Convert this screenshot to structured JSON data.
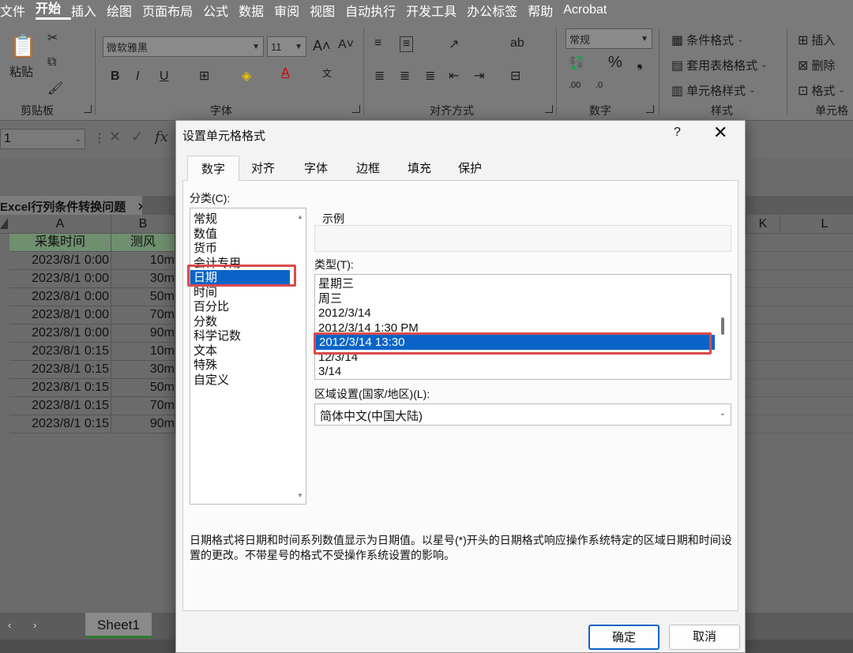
{
  "menu": [
    "文件",
    "开始",
    "插入",
    "绘图",
    "页面布局",
    "公式",
    "数据",
    "审阅",
    "视图",
    "自动执行",
    "开发工具",
    "办公标签",
    "帮助",
    "Acrobat"
  ],
  "ribbon": {
    "clipboard": {
      "paste": "粘贴",
      "group": "剪贴板"
    },
    "font": {
      "name": "微软雅黑",
      "size": "11",
      "group": "字体"
    },
    "align": {
      "group": "对齐方式"
    },
    "number": {
      "format": "常规",
      "group": "数字"
    },
    "styles": {
      "conditional": "条件格式",
      "table": "套用表格格式",
      "cell": "单元格样式",
      "group": "样式"
    },
    "cells": {
      "insert": "插入",
      "delete": "删除",
      "format": "格式",
      "group": "单元格"
    }
  },
  "formula": {
    "namebox": "1"
  },
  "workbook": {
    "tab": "Excel行列条件转换问题"
  },
  "sheet": {
    "columns": [
      "A",
      "B",
      "K",
      "L"
    ],
    "header": [
      "采集时间",
      "测风"
    ],
    "rows": [
      [
        "2023/8/1 0:00",
        "10m"
      ],
      [
        "2023/8/1 0:00",
        "30m"
      ],
      [
        "2023/8/1 0:00",
        "50m"
      ],
      [
        "2023/8/1 0:00",
        "70m"
      ],
      [
        "2023/8/1 0:00",
        "90m"
      ],
      [
        "2023/8/1 0:15",
        "10m"
      ],
      [
        "2023/8/1 0:15",
        "30m"
      ],
      [
        "2023/8/1 0:15",
        "50m"
      ],
      [
        "2023/8/1 0:15",
        "70m"
      ],
      [
        "2023/8/1 0:15",
        "90m"
      ]
    ],
    "sheet_tab": "Sheet1"
  },
  "dialog": {
    "title": "设置单元格格式",
    "help": "?",
    "tabs": [
      "数字",
      "对齐",
      "字体",
      "边框",
      "填充",
      "保护"
    ],
    "category_label": "分类(C):",
    "categories": [
      "常规",
      "数值",
      "货币",
      "会计专用",
      "日期",
      "时间",
      "百分比",
      "分数",
      "科学记数",
      "文本",
      "特殊",
      "自定义"
    ],
    "selected_category": "日期",
    "sample_label": "示例",
    "type_label": "类型(T):",
    "types": [
      "星期三",
      "周三",
      "2012/3/14",
      "2012/3/14 1:30 PM",
      "2012/3/14 13:30",
      "12/3/14",
      "3/14"
    ],
    "selected_type": "2012/3/14 13:30",
    "locale_label": "区域设置(国家/地区)(L):",
    "locale_value": "简体中文(中国大陆)",
    "description": "日期格式将日期和时间系列数值显示为日期值。以星号(*)开头的日期格式响应操作系统特定的区域日期和时间设置的更改。不带星号的格式不受操作系统设置的影响。",
    "ok": "确定",
    "cancel": "取消"
  },
  "colors": {
    "accent": "#0a64c8",
    "highlight": "#d94b4b",
    "sheet_green": "#2e7d32"
  }
}
